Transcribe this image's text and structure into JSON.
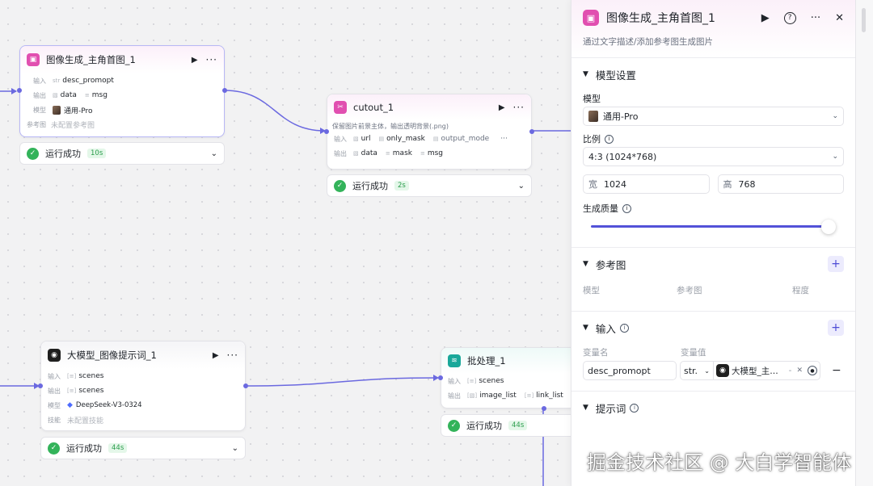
{
  "nodes": {
    "image_gen": {
      "title": "图像生成_主角首图_1",
      "input_label": "输入",
      "input_type": "str",
      "input_value": "desc_promopt",
      "output_label": "输出",
      "output_items": [
        "data",
        "msg"
      ],
      "model_label": "模型",
      "model_value": "通用-Pro",
      "ref_label": "参考图",
      "ref_value": "未配置参考图",
      "status": "运行成功",
      "duration": "10s"
    },
    "cutout": {
      "title": "cutout_1",
      "desc": "保留图片前景主体，输出透明背景(.png)",
      "input_label": "输入",
      "input_items": [
        "url",
        "only_mask",
        "output_mode"
      ],
      "output_label": "输出",
      "output_items": [
        "data",
        "mask",
        "msg"
      ],
      "status": "运行成功",
      "duration": "2s"
    },
    "llm": {
      "title": "大模型_图像提示词_1",
      "input_label": "输入",
      "input_value": "scenes",
      "output_label": "输出",
      "output_value": "scenes",
      "model_label": "模型",
      "model_value": "DeepSeek-V3-0324",
      "skill_label": "技能",
      "skill_value": "未配置技能",
      "status": "运行成功",
      "duration": "44s"
    },
    "batch": {
      "title": "批处理_1",
      "input_label": "输入",
      "input_value": "scenes",
      "output_label": "输出",
      "output_items": [
        "image_list",
        "link_list"
      ],
      "status": "运行成功",
      "duration": "44s"
    }
  },
  "panel": {
    "title": "图像生成_主角首图_1",
    "desc": "通过文字描述/添加参考图生成图片",
    "model_settings": "模型设置",
    "model_label": "模型",
    "model_value": "通用-Pro",
    "ratio_label": "比例",
    "ratio_value": "4:3 (1024*768)",
    "width_label": "宽",
    "width_value": "1024",
    "height_label": "高",
    "height_value": "768",
    "quality_label": "生成质量",
    "quality_level": 1.0,
    "ref_section": "参考图",
    "ref_cols": [
      "模型",
      "参考图",
      "程度"
    ],
    "input_section": "输入",
    "var_name_col": "变量名",
    "var_value_col": "变量值",
    "var_name": "desc_promopt",
    "var_type": "str.",
    "var_ref": "大模型_主…",
    "var_ref_sep": "-",
    "prompt_section": "提示词"
  },
  "icons": {
    "play": "play-icon",
    "help": "help-icon",
    "more": "more-icon",
    "close": "close-icon"
  },
  "watermark": "掘金技术社区 @ 大白学智能体",
  "colors": {
    "accent": "#5352d8",
    "image_node": "#e14fb0",
    "batch_node": "#19a89a",
    "success": "#33b35a"
  }
}
